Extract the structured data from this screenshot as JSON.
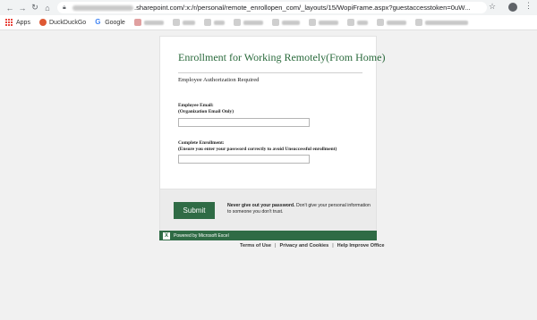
{
  "browser": {
    "url_domain": ".sharepoint.com",
    "url_path": "/:x:/r/personal/remote_enrollopen_com/_layouts/15/WopiFrame.aspx?guestaccesstoken=0uW..."
  },
  "bookmarks": {
    "apps": "Apps",
    "duckduckgo": "DuckDuckGo",
    "google": "Google"
  },
  "form": {
    "title": "Enrollment for Working Remotely(From Home)",
    "subtitle": "Employee Authorization Required",
    "email_label_line1": "Employee Email:",
    "email_label_line2": "(Organization Email Only)",
    "email_value": "",
    "password_label_line1": "Complete Enrollment:",
    "password_label_line2": "(Ensure you enter your password correctly to avoid Unsuccessful enrollment)",
    "password_value": ""
  },
  "footer": {
    "submit_label": "Submit",
    "warning_bold": "Never give out your password.",
    "warning_text": " Don't give your personal information to someone you don't trust."
  },
  "excel_bar": {
    "powered_by": "Powered by Microsoft Excel"
  },
  "links": {
    "terms": "Terms of Use",
    "privacy": "Privacy and Cookies",
    "help": "Help Improve Office"
  },
  "colors": {
    "brand_green": "#2f6b45",
    "title_green": "#2a6a3c"
  }
}
